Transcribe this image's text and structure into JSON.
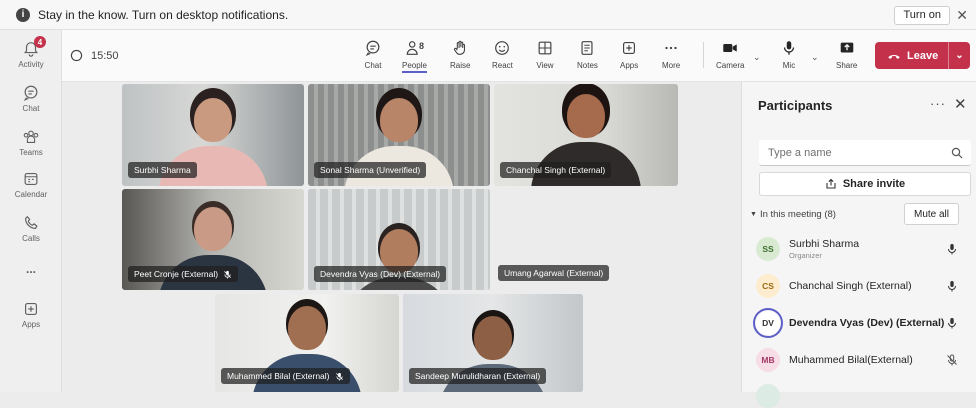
{
  "notification": {
    "text": "Stay in the know. Turn on desktop notifications.",
    "button": "Turn on"
  },
  "rail": {
    "items": [
      {
        "label": "Activity",
        "icon": "bell-icon",
        "badge": "4"
      },
      {
        "label": "Chat",
        "icon": "chat-icon"
      },
      {
        "label": "Teams",
        "icon": "teams-icon"
      },
      {
        "label": "Calendar",
        "icon": "calendar-icon"
      },
      {
        "label": "Calls",
        "icon": "phone-icon"
      },
      {
        "label": "...",
        "icon": "more-icon"
      },
      {
        "label": "Apps",
        "icon": "apps-icon"
      }
    ]
  },
  "toolbar": {
    "timer": "15:50",
    "chat": "Chat",
    "people": "People",
    "people_count": "8",
    "raise": "Raise",
    "react": "React",
    "view": "View",
    "notes": "Notes",
    "apps": "Apps",
    "more": "More",
    "camera": "Camera",
    "mic": "Mic",
    "share": "Share",
    "leave": "Leave"
  },
  "tiles": [
    {
      "name": "Surbhi Sharma"
    },
    {
      "name": "Sonal Sharma (Unverified)"
    },
    {
      "name": "Chanchal Singh (External)"
    },
    {
      "name": "Peet Cronje (External)"
    },
    {
      "name": "Devendra Vyas (Dev) (External)"
    },
    {
      "name": "Umang Agarwal (External)"
    },
    {
      "name": "Muhammed Bilal (External)"
    },
    {
      "name": "Sandeep Murulidharan (External)"
    }
  ],
  "panel": {
    "title": "Participants",
    "search_placeholder": "Type a name",
    "share_invite": "Share invite",
    "section": "In this meeting (8)",
    "mute_all": "Mute all",
    "participants": [
      {
        "initials": "SS",
        "name": "Surbhi Sharma",
        "role": "Organizer",
        "avatar_bg": "#d9ead3",
        "avatar_fg": "#3f6e2f"
      },
      {
        "initials": "CS",
        "name": "Chanchal Singh (External)",
        "role": "",
        "avatar_bg": "#fdeccd",
        "avatar_fg": "#9a6b12"
      },
      {
        "initials": "DV",
        "name": "Devendra Vyas (Dev) (External)",
        "role": "",
        "avatar_bg": "#e6e7fb",
        "avatar_fg": "#3c3f8f"
      },
      {
        "initials": "MB",
        "name": "Muhammed Bilal(External)",
        "role": "",
        "avatar_bg": "#f6dde6",
        "avatar_fg": "#a33b65"
      }
    ]
  }
}
